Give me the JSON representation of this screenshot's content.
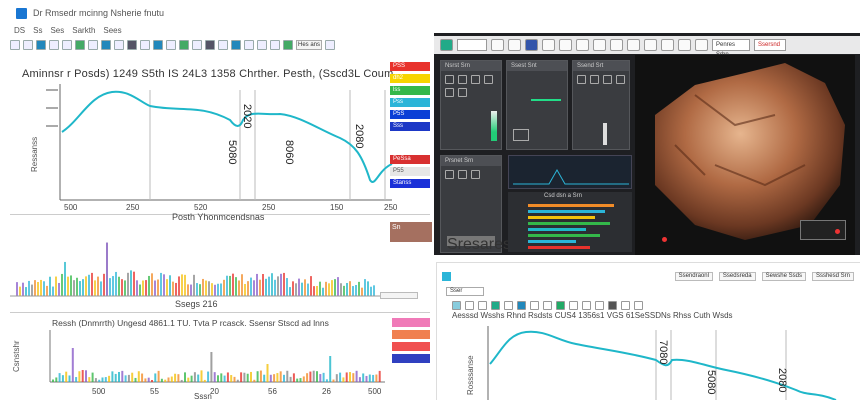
{
  "left_app": {
    "window_title": "Dr Rmsedr mcinng Nsherie fnutu",
    "menu": [
      "DS",
      "Ss",
      "Ses",
      "Sarkth",
      "Sees"
    ],
    "toolbar_field": "Hes ans",
    "chart_title": "Aminnsr r Posds)    1249 S5th IS 24L3 1358 Chrther.   Pesth,  (Sscd3L Coum",
    "y_axis_label": "Ressanss",
    "peak_labels": [
      "2020",
      "5080",
      "8060",
      "2080"
    ],
    "x_ticks": [
      "500",
      "250",
      "520",
      "250",
      "150",
      "250"
    ],
    "mid_section_title": "Posth Yhonmcendsnas",
    "mid_section_label": "Ssegs 216",
    "lower_chart_title": "Ressh (Dnmrrth) Ungesd 4861.1 TU.  Tvta P rcasck.   Ssensr Stscd ad lnns",
    "lower_y_label": "Csnstshr",
    "lower_x_ticks": [
      "500",
      "55",
      "20",
      "56",
      "26",
      "500"
    ],
    "lower_axis_caption": "Sssn",
    "legend_labels": [
      "PSS",
      "dh2",
      "lss",
      "Pss",
      "P5S",
      "Sss"
    ],
    "legend_colors": [
      "#e8322c",
      "#f7d400",
      "#34b84a",
      "#2bb5d8",
      "#0a3fd6",
      "#1d38c6"
    ],
    "mid_legend_labels": [
      "PeSsa",
      "P55",
      "Stanss"
    ],
    "mid_legend_colors": [
      "#d83030",
      "#e6e6e6",
      "#1a30d8"
    ],
    "side_thumb_label": "Sn",
    "lower_legend_colors": [
      "#f07ab8",
      "#f08050",
      "#f05050",
      "#3040c0"
    ],
    "series_color": "#1fb7c9"
  },
  "right_top": {
    "field_right": "Penres Srhn",
    "field_right2": "Ssersnd",
    "card_titles": [
      "Nsrst Srn",
      "Ssest Snt",
      "Ssend Srt",
      "Prsnet Srn"
    ],
    "bar_panel_title": "Csd dsn a Srn",
    "bottom_card_title": "Sresaresd"
  },
  "right_bottom": {
    "fields": [
      "Ssendraonl",
      "Ssedsreda",
      "Sewshe Ssds",
      "Ssshesd Srn"
    ],
    "tab_label": "Sser",
    "chart_title": "Aesssd Wsshs   Rhnd  Rsdsts CUS4 1356s1 VGS 61SeSSDNs Rhss  Cuth Wsds",
    "y_label": "Rosssanse",
    "peak_labels": [
      "7080",
      "5080",
      "2080"
    ],
    "series_color": "#1fb7c9"
  },
  "chart_data": [
    {
      "type": "line",
      "title": "",
      "xlabel": "",
      "ylabel": "Ressanss",
      "x": [
        500,
        700,
        900,
        1100,
        1300,
        1500,
        1700,
        1900,
        2100,
        2300,
        2500
      ],
      "y": [
        0.55,
        0.95,
        0.9,
        0.72,
        0.66,
        0.7,
        0.52,
        0.58,
        0.55,
        0.32,
        0.05
      ],
      "grid": false
    },
    {
      "type": "line",
      "title": "",
      "ylabel": "Rosssanse",
      "x": [
        500,
        800,
        1100,
        1400,
        1700,
        2000,
        2300,
        2600
      ],
      "y": [
        0.7,
        0.95,
        0.85,
        0.75,
        0.72,
        0.65,
        0.45,
        0.2
      ],
      "grid": false
    }
  ]
}
